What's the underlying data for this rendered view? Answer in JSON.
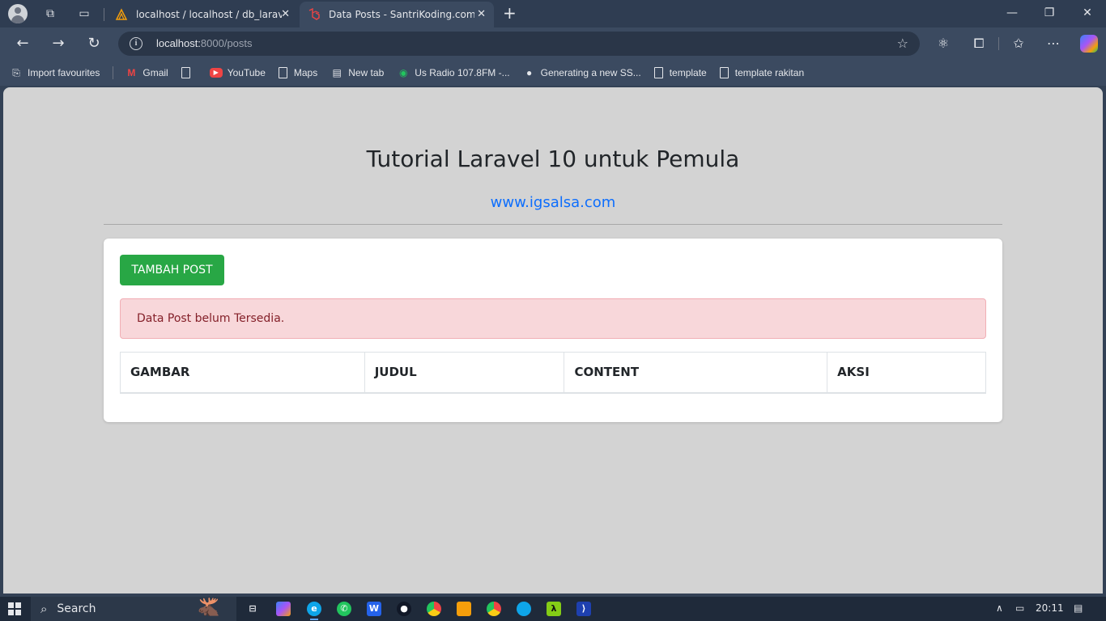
{
  "browser": {
    "tabs": [
      {
        "label": "localhost / localhost / db_laravel_",
        "active": false,
        "favicon": "phpmyadmin-icon"
      },
      {
        "label": "Data Posts - SantriKoding.com",
        "active": true,
        "favicon": "laravel-icon"
      }
    ],
    "close_glyph": "✕",
    "new_tab_glyph": "+",
    "window": {
      "minimize": "—",
      "restore": "❐",
      "close": "✕"
    },
    "url_host": "localhost:",
    "url_path": "8000/posts"
  },
  "bookmarks": [
    {
      "label": "Import favourites",
      "icon": "import-icon"
    },
    {
      "label": "Gmail",
      "icon": "gmail-icon"
    },
    {
      "label": "",
      "icon": "page-icon"
    },
    {
      "label": "YouTube",
      "icon": "youtube-icon"
    },
    {
      "label": "Maps",
      "icon": "page-icon"
    },
    {
      "label": "New tab",
      "icon": "newtab-icon"
    },
    {
      "label": "Us Radio 107.8FM -...",
      "icon": "radio-icon"
    },
    {
      "label": "Generating a new SS...",
      "icon": "github-icon"
    },
    {
      "label": "template",
      "icon": "page-icon"
    },
    {
      "label": "template rakitan",
      "icon": "page-icon"
    }
  ],
  "page": {
    "title": "Tutorial Laravel 10 untuk Pemula",
    "link": "www.igsalsa.com",
    "add_button": "TAMBAH POST",
    "alert": "Data Post belum Tersedia.",
    "table_headers": [
      "GAMBAR",
      "JUDUL",
      "CONTENT",
      "AKSI"
    ]
  },
  "taskbar": {
    "search_label": "Search",
    "time": "20:11"
  },
  "colors": {
    "accent_link": "#0d6efd",
    "button_success": "#28a745",
    "alert_bg": "#f8d7da",
    "alert_text": "#842029"
  }
}
